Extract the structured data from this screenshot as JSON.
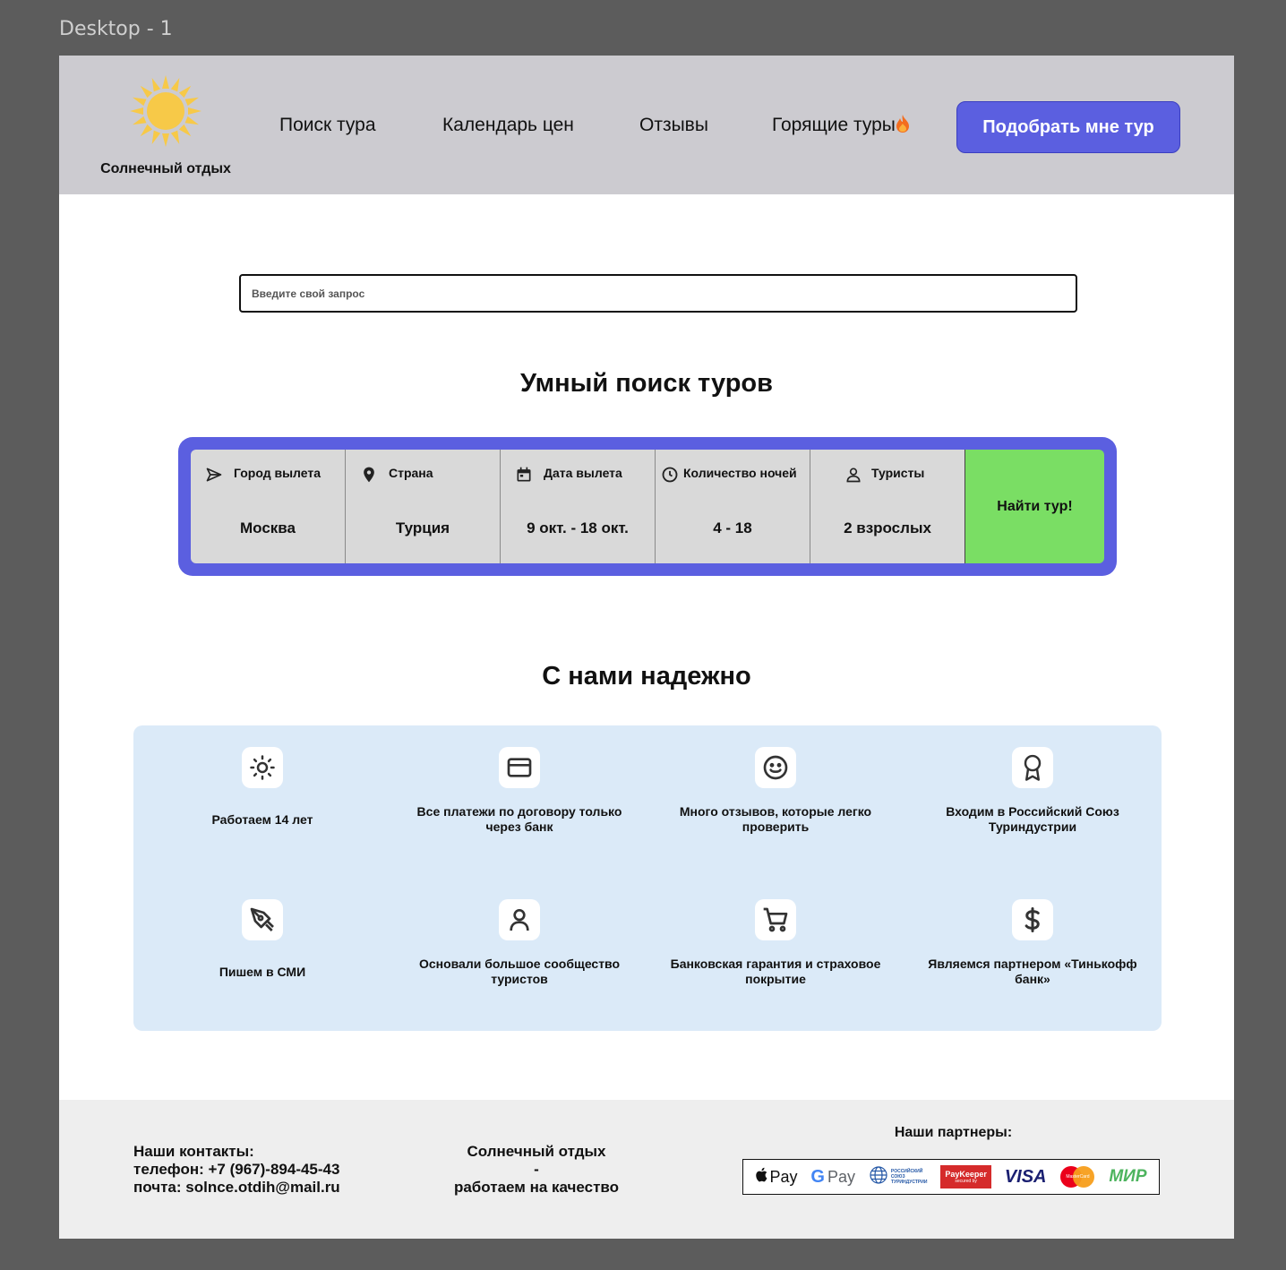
{
  "frame": {
    "label": "Desktop - 1"
  },
  "header": {
    "logo_text": "Солнечный отдых",
    "nav": [
      {
        "label": "Поиск тура"
      },
      {
        "label": "Календарь цен"
      },
      {
        "label": "Отзывы"
      },
      {
        "label": "Горящие туры"
      }
    ],
    "cta_label": "Подобрать мне тур"
  },
  "search": {
    "placeholder": "Введите свой запрос"
  },
  "smart_search": {
    "title": "Умный поиск туров",
    "fields": [
      {
        "label": "Город вылета",
        "value": "Москва",
        "icon": "send-icon"
      },
      {
        "label": "Страна",
        "value": "Турция",
        "icon": "map-pin-icon"
      },
      {
        "label": "Дата вылета",
        "value": "9 окт. - 18 окт.",
        "icon": "calendar-icon"
      },
      {
        "label": "Количество ночей",
        "value": "4 - 18",
        "icon": "clock-icon"
      },
      {
        "label": "Туристы",
        "value": "2 взрослых",
        "icon": "user-icon"
      }
    ],
    "submit_label": "Найти тур!"
  },
  "reliability": {
    "title": "С нами надежно",
    "items": [
      {
        "text": "Работаем 14 лет",
        "icon": "sun-icon"
      },
      {
        "text": "Все платежи по договору только через банк",
        "icon": "credit-card-icon"
      },
      {
        "text": "Много отзывов, которые легко проверить",
        "icon": "smile-icon"
      },
      {
        "text": "Входим в Российский Союз Туриндустрии",
        "icon": "award-icon"
      },
      {
        "text": "Пишем в СМИ",
        "icon": "pen-tool-icon"
      },
      {
        "text": "Основали большое сообщество туристов",
        "icon": "user-icon"
      },
      {
        "text": "Банковская гарантия и страховое покрытие",
        "icon": "shopping-cart-icon"
      },
      {
        "text": "Являемся партнером «Тинькофф банк»",
        "icon": "dollar-icon"
      }
    ]
  },
  "footer": {
    "contacts_title": "Наши контакты:",
    "phone": "телефон: +7 (967)-894-45-43",
    "email": "почта: solnce.otdih@mail.ru",
    "slogan_line1": "Солнечный отдых",
    "slogan_line2": "-",
    "slogan_line3": "работаем на качество",
    "partners_title": "Наши партнеры:",
    "partners": {
      "apple_pay": "Pay",
      "google_pay": "Pay",
      "rst_line1": "РОССИЙСКИЙ",
      "rst_line2": "СОЮЗ",
      "rst_line3": "ТУРИНДУСТРИИ",
      "paykeeper": "PayKeeper",
      "paykeeper_sub": "secured by",
      "visa": "VISA",
      "mastercard": "MasterCard",
      "mir": "МИР"
    }
  },
  "colors": {
    "header_bg": "#cccbd0",
    "accent": "#5b5fe0",
    "find_button": "#7ade64",
    "features_bg": "#dbeaf8",
    "footer_bg": "#eeeeee",
    "sun": "#f7c948"
  }
}
